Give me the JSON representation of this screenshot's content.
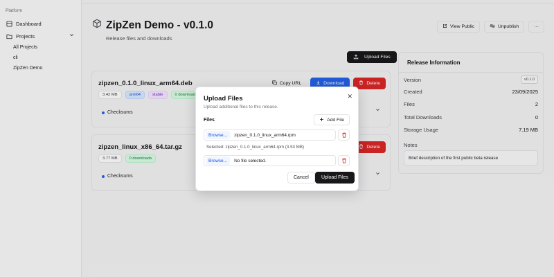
{
  "sidebar": {
    "group_label": "Platform",
    "items": [
      {
        "label": "Dashboard",
        "icon": "dashboard-icon"
      },
      {
        "label": "Projects",
        "icon": "folder-icon"
      }
    ],
    "sub_items": [
      "All Projects",
      "cli",
      "ZipZen Demo"
    ]
  },
  "header": {
    "title": "ZipZen Demo - v0.1.0",
    "subtitle": "Release files and downloads",
    "view_public_label": "View Public",
    "unpublish_label": "Unpublish",
    "more_label": "···"
  },
  "upload_files_label": "Upload Files",
  "files": [
    {
      "name": "zipzen_0.1.0_linux_arm64.deb",
      "size": "3.42 MB",
      "arch": "arm64",
      "channel": "stable",
      "downloads": "0 downloads",
      "copy_url_label": "Copy URL",
      "download_label": "Download",
      "delete_label": "Delete",
      "checksums_label": "Checksums"
    },
    {
      "name": "zipzen_linux_x86_64.tar.gz",
      "size": "3.77 MB",
      "downloads": "0 downloads",
      "delete_label": "Delete",
      "checksums_label": "Checksums"
    }
  ],
  "release_info": {
    "title": "Release Information",
    "version_label": "Version",
    "version": "v0.1.0",
    "created_label": "Created",
    "created": "23/09/2025",
    "files_label": "Files",
    "files": "2",
    "downloads_label": "Total Downloads",
    "downloads": "0",
    "storage_label": "Storage Usage",
    "storage": "7.19 MB",
    "notes_label": "Notes",
    "notes": "Brief description of the first public beta release"
  },
  "modal": {
    "title": "Upload Files",
    "subtitle": "Upload additional files to this release.",
    "files_label": "Files",
    "add_file_label": "Add File",
    "browse_label": "Browse...",
    "file1": "zipzen_0.1.0_linux_arm64.rpm",
    "selected_text": "Selected: zipzen_0.1.0_linux_arm64.rpm (3.53 MB)",
    "file2": "No file selected.",
    "cancel_label": "Cancel",
    "upload_label": "Upload Files",
    "close_symbol": "✕"
  },
  "colors": {
    "primary": "#18181b",
    "download_blue": "#2563eb",
    "delete_red": "#dc2626"
  }
}
